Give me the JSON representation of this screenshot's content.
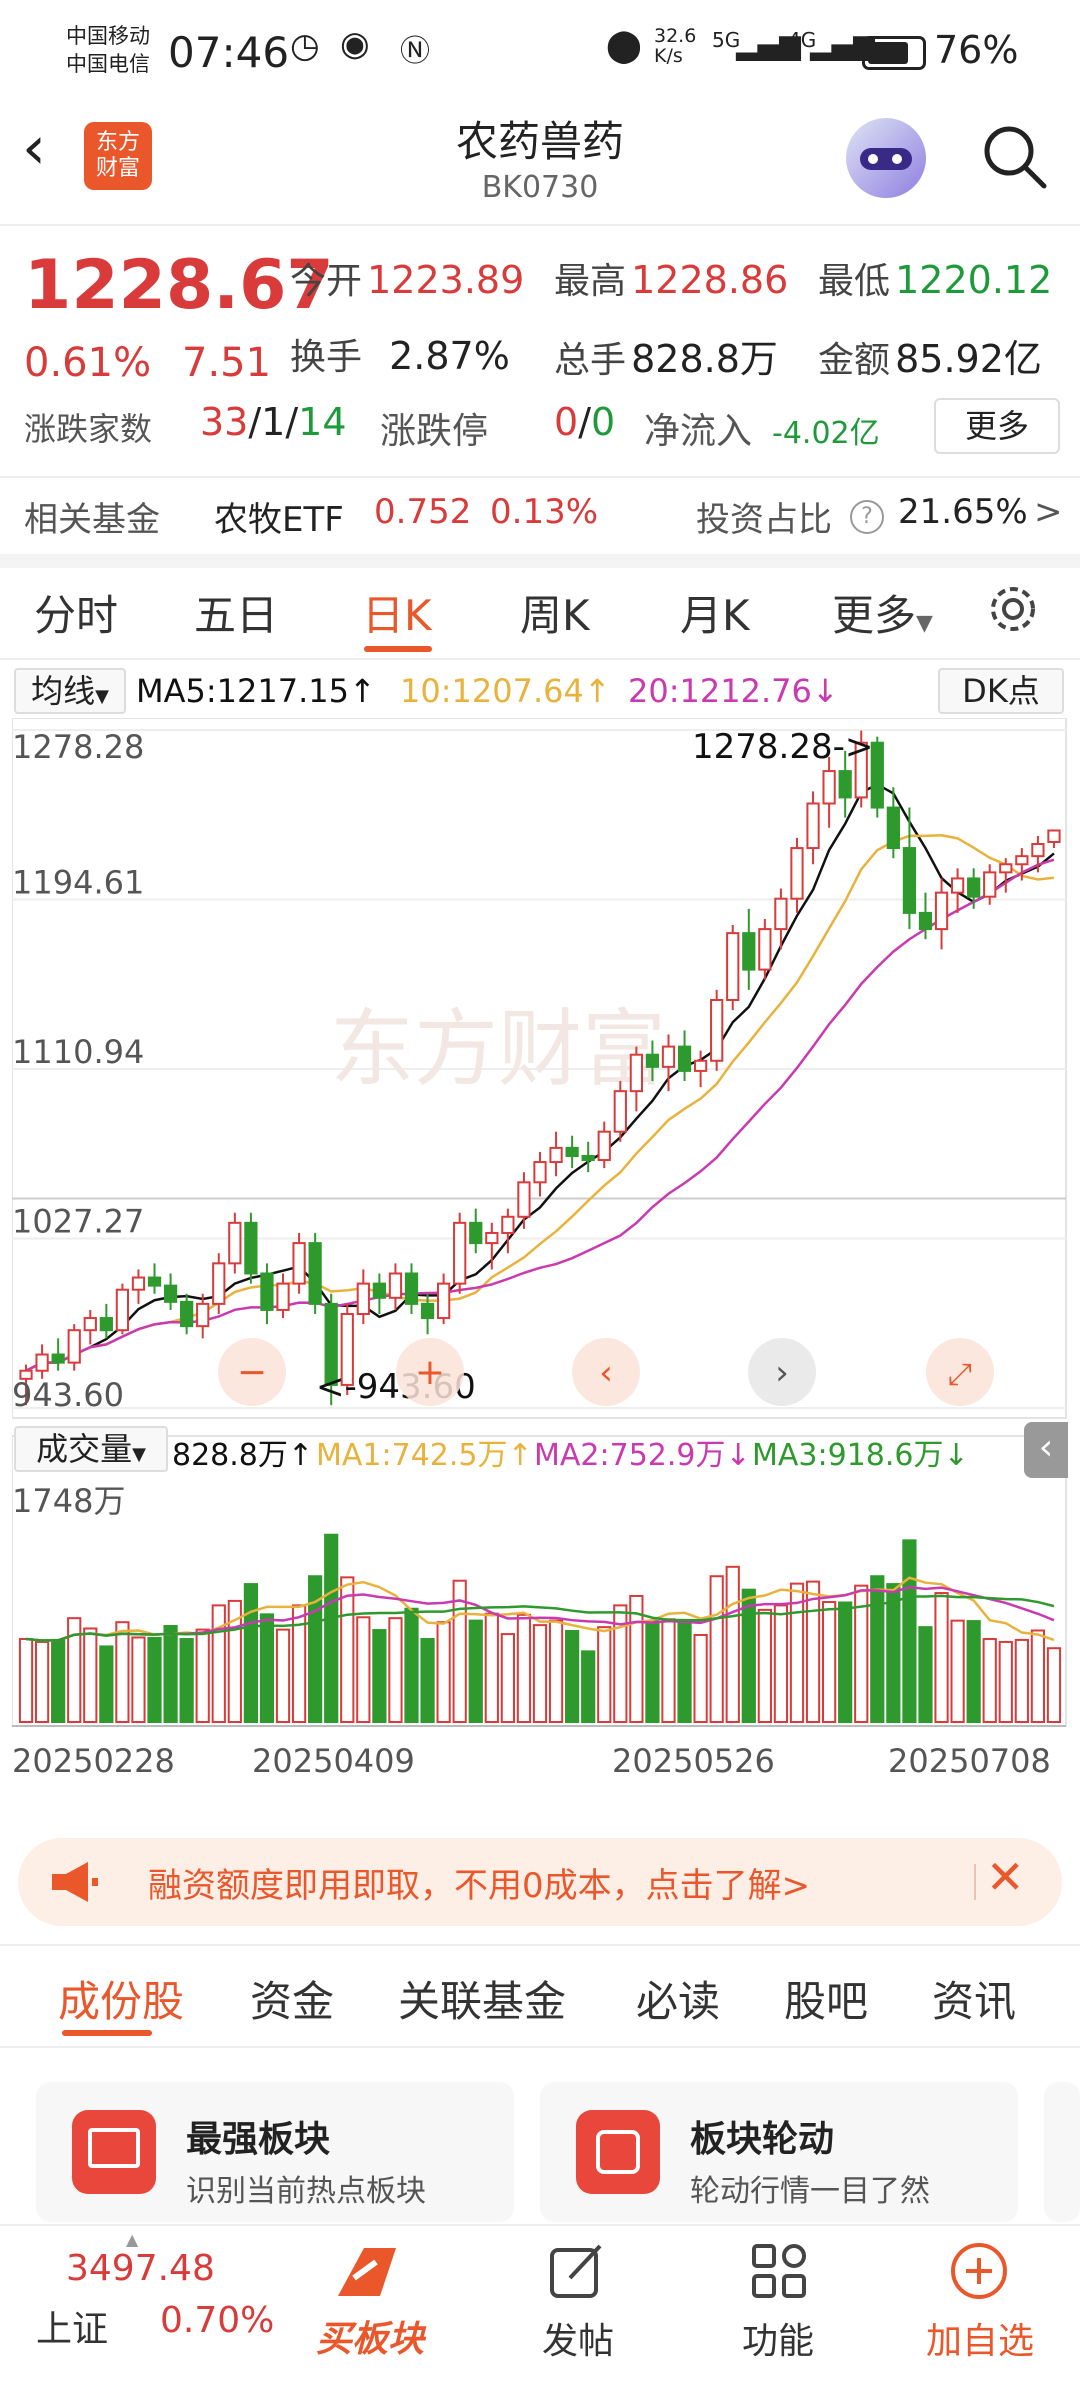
{
  "status": {
    "carrier1": "中国移动",
    "carrier2": "中国电信",
    "time": "07:46",
    "speed_top": "32.6",
    "speed_bottom": "K/s",
    "net1": "5G",
    "net2": "4G",
    "battery": "76%"
  },
  "header": {
    "logo_line1": "东方",
    "logo_line2": "财富",
    "title": "农药兽药",
    "code": "BK0730"
  },
  "quote": {
    "price": "1228.67",
    "pct": "0.61%",
    "change": "7.51",
    "open_label": "今开",
    "open": "1223.89",
    "high_label": "最高",
    "high": "1228.86",
    "low_label": "最低",
    "low": "1220.12",
    "turnover_label": "换手",
    "turnover": "2.87%",
    "volume_label": "总手",
    "volume": "828.8万",
    "amount_label": "金额",
    "amount": "85.92亿",
    "breadth_label": "涨跌家数",
    "breadth_up": "33",
    "breadth_flat": "1",
    "breadth_down": "14",
    "limit_label": "涨跌停",
    "limit_up": "0",
    "limit_down": "0",
    "netflow_label": "净流入",
    "netflow": "-4.02亿",
    "more": "更多"
  },
  "fund": {
    "label": "相关基金",
    "name": "农牧ETF",
    "price": "0.752",
    "pct": "0.13%",
    "ratio_label": "投资占比",
    "ratio": "21.65%",
    "arrow": ">"
  },
  "ktabs": [
    "分时",
    "五日",
    "日K",
    "周K",
    "月K",
    "更多"
  ],
  "chart": {
    "ma_selector": "均线",
    "ma5": "MA5:1217.15↑",
    "ma10": "10:1207.64↑",
    "ma20": "20:1212.76↓",
    "dk": "DK点",
    "y_labels": [
      "1278.28",
      "1194.61",
      "1110.94",
      "1027.27",
      "943.60"
    ],
    "max_annot": "1278.28->",
    "min_annot": "<-943.60",
    "watermark": "东方财富",
    "vol_selector": "成交量",
    "vol_value": "828.8万↑",
    "vol_ma1": "MA1:742.5万↑",
    "vol_ma2": "MA2:752.9万↓",
    "vol_ma3": "MA3:918.6万↓",
    "vol_max": "1748万",
    "dates": [
      "20250228",
      "20250409",
      "20250526",
      "20250708"
    ],
    "colors": {
      "up": "#d93a3a",
      "down": "#2e9a2e",
      "ma5": "#111111",
      "ma10": "#e8b23c",
      "ma20": "#c93ab0"
    }
  },
  "chart_data": {
    "type": "candlestick",
    "y_range": [
      943.6,
      1278.28
    ],
    "candles": [
      [
        958,
        965,
        945,
        962
      ],
      [
        962,
        975,
        958,
        970
      ],
      [
        970,
        978,
        962,
        966
      ],
      [
        966,
        985,
        962,
        982
      ],
      [
        982,
        992,
        975,
        988
      ],
      [
        988,
        995,
        978,
        982
      ],
      [
        982,
        1005,
        980,
        1002
      ],
      [
        1002,
        1012,
        995,
        1008
      ],
      [
        1008,
        1015,
        1000,
        1004
      ],
      [
        1004,
        1010,
        992,
        996
      ],
      [
        996,
        1000,
        980,
        984
      ],
      [
        984,
        1000,
        978,
        995
      ],
      [
        995,
        1020,
        990,
        1015
      ],
      [
        1015,
        1040,
        1010,
        1035
      ],
      [
        1035,
        1040,
        1005,
        1010
      ],
      [
        1010,
        1015,
        985,
        992
      ],
      [
        992,
        1010,
        988,
        1005
      ],
      [
        1005,
        1030,
        1000,
        1025
      ],
      [
        1025,
        1030,
        990,
        995
      ],
      [
        995,
        1000,
        945,
        955
      ],
      [
        955,
        995,
        950,
        990
      ],
      [
        990,
        1012,
        985,
        1005
      ],
      [
        1005,
        1010,
        990,
        998
      ],
      [
        998,
        1015,
        992,
        1010
      ],
      [
        1010,
        1015,
        990,
        995
      ],
      [
        995,
        1000,
        980,
        988
      ],
      [
        988,
        1010,
        985,
        1005
      ],
      [
        1005,
        1040,
        1000,
        1035
      ],
      [
        1035,
        1042,
        1020,
        1025
      ],
      [
        1025,
        1035,
        1012,
        1030
      ],
      [
        1030,
        1042,
        1020,
        1038
      ],
      [
        1038,
        1060,
        1032,
        1055
      ],
      [
        1055,
        1070,
        1048,
        1065
      ],
      [
        1065,
        1080,
        1058,
        1072
      ],
      [
        1072,
        1078,
        1062,
        1068
      ],
      [
        1068,
        1075,
        1060,
        1066
      ],
      [
        1066,
        1085,
        1062,
        1080
      ],
      [
        1080,
        1105,
        1075,
        1100
      ],
      [
        1100,
        1122,
        1090,
        1118
      ],
      [
        1118,
        1125,
        1105,
        1112
      ],
      [
        1112,
        1128,
        1100,
        1122
      ],
      [
        1122,
        1130,
        1105,
        1110
      ],
      [
        1110,
        1120,
        1102,
        1115
      ],
      [
        1115,
        1150,
        1110,
        1145
      ],
      [
        1145,
        1182,
        1140,
        1178
      ],
      [
        1178,
        1190,
        1150,
        1160
      ],
      [
        1160,
        1185,
        1155,
        1180
      ],
      [
        1180,
        1200,
        1170,
        1195
      ],
      [
        1195,
        1225,
        1188,
        1220
      ],
      [
        1220,
        1248,
        1212,
        1242
      ],
      [
        1242,
        1265,
        1230,
        1258
      ],
      [
        1258,
        1268,
        1235,
        1245
      ],
      [
        1245,
        1278,
        1240,
        1272
      ],
      [
        1272,
        1275,
        1235,
        1240
      ],
      [
        1240,
        1250,
        1215,
        1220
      ],
      [
        1220,
        1240,
        1180,
        1188
      ],
      [
        1188,
        1198,
        1175,
        1180
      ],
      [
        1180,
        1205,
        1170,
        1198
      ],
      [
        1198,
        1210,
        1188,
        1205
      ],
      [
        1205,
        1210,
        1190,
        1196
      ],
      [
        1196,
        1212,
        1192,
        1208
      ],
      [
        1208,
        1215,
        1198,
        1212
      ],
      [
        1212,
        1220,
        1204,
        1216
      ],
      [
        1216,
        1226,
        1208,
        1222
      ],
      [
        1223,
        1229,
        1220,
        1228.67
      ]
    ],
    "volume_max": 1748
  },
  "banner": {
    "text": "融资额度即用即取，不用0成本，点击了解>"
  },
  "btabs": [
    "成份股",
    "资金",
    "关联基金",
    "必读",
    "股吧",
    "资讯"
  ],
  "cards": [
    {
      "title": "最强板块",
      "sub": "识别当前热点板块"
    },
    {
      "title": "板块轮动",
      "sub": "轮动行情一目了然"
    }
  ],
  "nav": {
    "index_value": "3497.48",
    "index_name": "上证",
    "index_pct": "0.70%",
    "buy": "买板块",
    "post": "发帖",
    "func": "功能",
    "add": "加自选"
  }
}
